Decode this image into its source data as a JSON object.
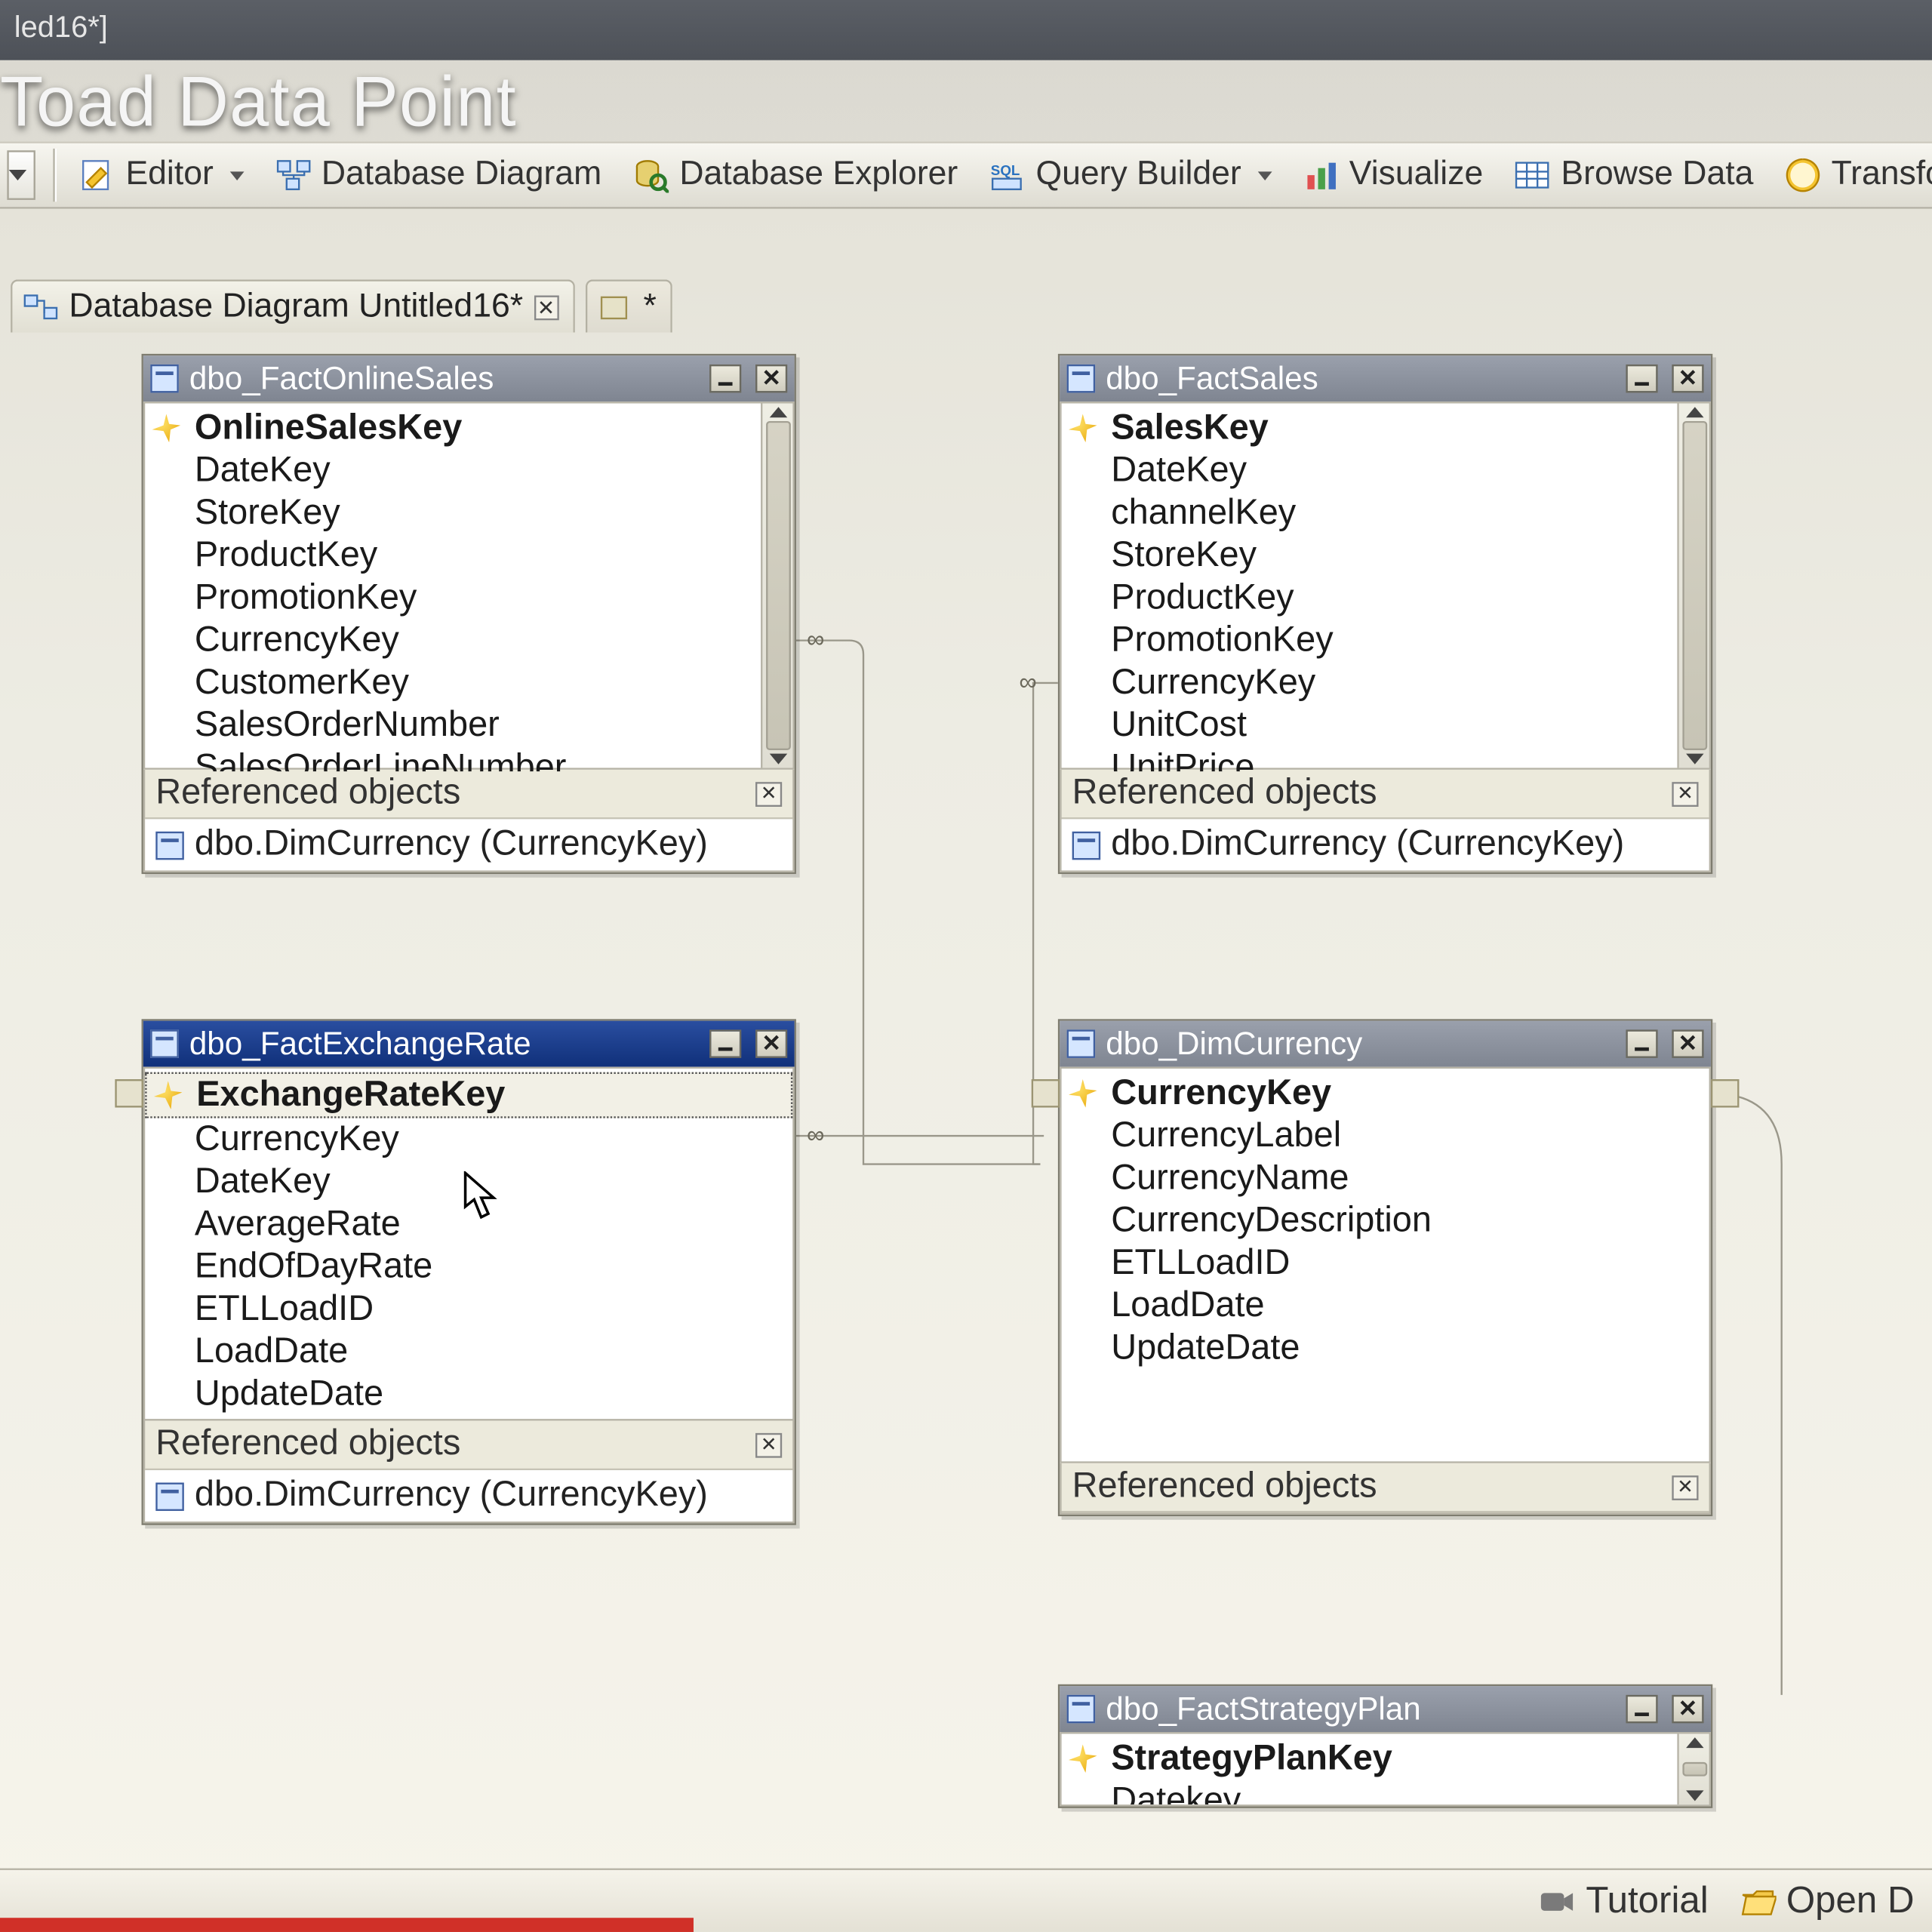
{
  "window": {
    "title_fragment": "led16*]"
  },
  "overlay_title": "Toad Data Point",
  "toolbar": {
    "editor": "Editor",
    "db_diagram": "Database Diagram",
    "db_explorer": "Database Explorer",
    "query_builder": "Query Builder",
    "visualize": "Visualize",
    "browse_data": "Browse Data",
    "transform": "Transform"
  },
  "doc_tabs": {
    "tab1": "Database Diagram Untitled16*",
    "tab2": "*"
  },
  "tables": {
    "fact_online_sales": {
      "title": "dbo_FactOnlineSales",
      "columns": [
        "OnlineSalesKey",
        "DateKey",
        "StoreKey",
        "ProductKey",
        "PromotionKey",
        "CurrencyKey",
        "CustomerKey",
        "SalesOrderNumber",
        "SalesOrderLineNumber"
      ],
      "referenced_label": "Referenced objects",
      "referenced": "dbo.DimCurrency (CurrencyKey)"
    },
    "fact_sales": {
      "title": "dbo_FactSales",
      "columns": [
        "SalesKey",
        "DateKey",
        "channelKey",
        "StoreKey",
        "ProductKey",
        "PromotionKey",
        "CurrencyKey",
        "UnitCost",
        "UnitPrice"
      ],
      "referenced_label": "Referenced objects",
      "referenced": "dbo.DimCurrency (CurrencyKey)"
    },
    "fact_exchange_rate": {
      "title": "dbo_FactExchangeRate",
      "columns": [
        "ExchangeRateKey",
        "CurrencyKey",
        "DateKey",
        "AverageRate",
        "EndOfDayRate",
        "ETLLoadID",
        "LoadDate",
        "UpdateDate"
      ],
      "referenced_label": "Referenced objects",
      "referenced": "dbo.DimCurrency (CurrencyKey)"
    },
    "dim_currency": {
      "title": "dbo_DimCurrency",
      "columns": [
        "CurrencyKey",
        "CurrencyLabel",
        "CurrencyName",
        "CurrencyDescription",
        "ETLLoadID",
        "LoadDate",
        "UpdateDate"
      ],
      "referenced_label": "Referenced objects"
    },
    "fact_strategy_plan": {
      "title": "dbo_FactStrategyPlan",
      "columns": [
        "StrategyPlanKey",
        "Datekey"
      ]
    }
  },
  "status": {
    "tutorial": "Tutorial",
    "open": "Open D"
  }
}
